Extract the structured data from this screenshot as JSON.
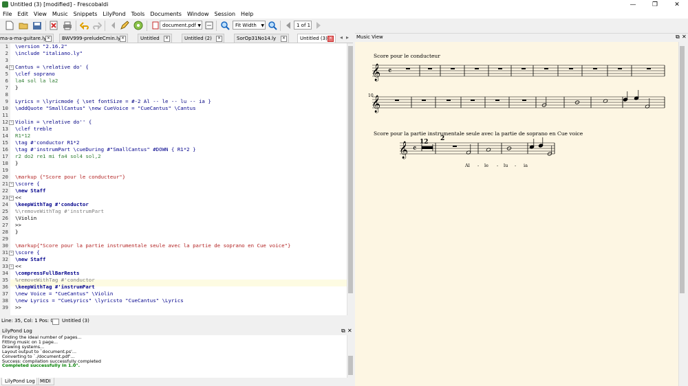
{
  "window": {
    "title": "Untitled (3) [modified] - Frescobaldi",
    "controls": [
      "—",
      "❐",
      "✕"
    ]
  },
  "menu": [
    "File",
    "Edit",
    "View",
    "Music",
    "Snippets",
    "LilyPond",
    "Tools",
    "Documents",
    "Window",
    "Session",
    "Help"
  ],
  "toolbar": {
    "document_combo": "document.pdf",
    "zoom_combo": "Fit Width",
    "page_combo": "1 of 1"
  },
  "tabs": [
    "ma-a-ma-guitare.ly",
    "BWV999-preludeCmin.ly",
    "Untitled",
    "Untitled (2)",
    "SorOp31No14.ly",
    "Untitled (3)"
  ],
  "code_lines": [
    {
      "n": "1",
      "t": "\\version \"2.16.2\""
    },
    {
      "n": "2",
      "t": "\\include \"italiano.ly\""
    },
    {
      "n": "3",
      "t": ""
    },
    {
      "n": "4",
      "t": "Cantus = \\relative do' {"
    },
    {
      "n": "5",
      "t": "\\clef soprano"
    },
    {
      "n": "6",
      "t": "la4 sol la la2"
    },
    {
      "n": "7",
      "t": "}"
    },
    {
      "n": "8",
      "t": ""
    },
    {
      "n": "9",
      "t": "Lyrics = \\lyricmode { \\set fontSize = #-2 Al -- le -- lu -- ia }"
    },
    {
      "n": "10",
      "t": "\\addQuote \"SmallCantus\" \\new CueVoice = \"CueCantus\" \\Cantus"
    },
    {
      "n": "11",
      "t": ""
    },
    {
      "n": "12",
      "t": "Violin = \\relative do'' {"
    },
    {
      "n": "13",
      "t": "\\clef treble"
    },
    {
      "n": "14",
      "t": "R1*12"
    },
    {
      "n": "15",
      "t": "\\tag #'conductor R1*2"
    },
    {
      "n": "16",
      "t": "\\tag #'instrumPart \\cueDuring #\"SmallCantus\" #DOWN { R1*2 }"
    },
    {
      "n": "17",
      "t": "r2 do2 re1 mi fa4 sol4 sol,2"
    },
    {
      "n": "18",
      "t": "}"
    },
    {
      "n": "19",
      "t": ""
    },
    {
      "n": "20",
      "t": "\\markup {\"Score pour le conducteur\"}"
    },
    {
      "n": "21",
      "t": "\\score {"
    },
    {
      "n": "22",
      "t": "\\new Staff"
    },
    {
      "n": "23",
      "t": "<<"
    },
    {
      "n": "24",
      "t": "\\keepWithTag #'conductor"
    },
    {
      "n": "25",
      "t": "%\\removeWithTag #'instrumPart"
    },
    {
      "n": "26",
      "t": "\\Violin"
    },
    {
      "n": "27",
      "t": ">>"
    },
    {
      "n": "28",
      "t": "}"
    },
    {
      "n": "29",
      "t": ""
    },
    {
      "n": "30",
      "t": "\\markup{\"Score pour la partie instrumentale seule avec la partie de soprano en Cue voice\"}"
    },
    {
      "n": "31",
      "t": "\\score {"
    },
    {
      "n": "32",
      "t": "\\new Staff"
    },
    {
      "n": "33",
      "t": "<<"
    },
    {
      "n": "34",
      "t": "\\compressFullBarRests"
    },
    {
      "n": "35",
      "t": "%removeWithTag #'conductor"
    },
    {
      "n": "36",
      "t": "\\keepWithTag #'instrumPart"
    },
    {
      "n": "37",
      "t": "\\new Voice = \"CueCantus\" \\Violin"
    },
    {
      "n": "38",
      "t": "\\new Lyrics = \"CueLyrics\" \\lyricsto \"CueCantus\" \\Lyrics"
    },
    {
      "n": "39",
      "t": ">>"
    }
  ],
  "status": {
    "position": "Line: 35, Col: 1  Pos: 0",
    "document": "Untitled (3)"
  },
  "log": {
    "title": "LilyPond Log",
    "lines": [
      "Finding the ideal number of pages...",
      "Fitting music on 1 page...",
      "Drawing systems...",
      "Layout output to `document.ps'...",
      "Converting to `./document.pdf'...",
      "Success: compilation successfully completed"
    ],
    "completed": "Completed successfully in 1.0\"."
  },
  "bottom_tabs": [
    "LilyPond Log",
    "MIDI"
  ],
  "music_view": {
    "title": "Music View",
    "score1_title": "Score pour le conducteur",
    "score2_title": "Score pour la partie instrumentale seule avec la partie de soprano en Cue voice",
    "measure_number": "10",
    "rest_count": "12",
    "time_sig_top": "2",
    "lyrics": [
      "Al",
      "-",
      "le",
      "-",
      "lu",
      "-",
      "ia"
    ]
  }
}
